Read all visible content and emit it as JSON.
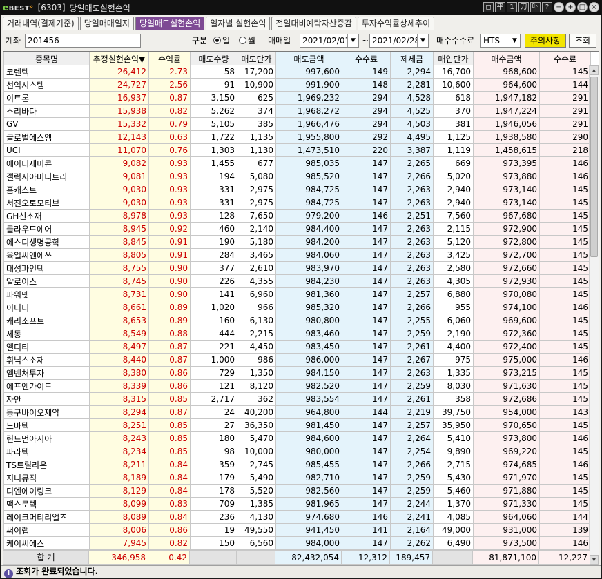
{
  "window": {
    "logo": "BEST",
    "code": "[6303]",
    "title": "당일매도실현손익",
    "buttons": [
      "◻",
      "平",
      "1",
      "刀",
      "卟",
      "?",
      "−",
      "+",
      "□",
      "×"
    ]
  },
  "tabs": [
    "거래내역(결제기준)",
    "당일매매일지",
    "당일매도실현손익",
    "일자별 실현손익",
    "전일대비예탁자산증감",
    "투자수익률상세추이"
  ],
  "active_tab": 2,
  "toolbar": {
    "account_label": "계좌",
    "account_value": "201456",
    "gubun_label": "구분",
    "radio_day": "일",
    "radio_month": "월",
    "trade_date_label": "매매일",
    "date_from": "2021/02/01",
    "tilde": "~",
    "date_to": "2021/02/28",
    "fee_label": "매수수수료",
    "fee_value": "HTS",
    "notice_button": "주의사항",
    "query_button": "조회",
    "dropdown_icon": "▼"
  },
  "columns": [
    "종목명",
    "추정실현손익▼",
    "수익률",
    "매도수량",
    "매도단가",
    "매도금액",
    "수수료",
    "제세금",
    "매입단가",
    "매수금액",
    "수수료"
  ],
  "rows": [
    [
      "코렌텍",
      "26,412",
      "2.73",
      "58",
      "17,200",
      "997,600",
      "149",
      "2,294",
      "16,700",
      "968,600",
      "145"
    ],
    [
      "선익시스템",
      "24,727",
      "2.56",
      "91",
      "10,900",
      "991,900",
      "148",
      "2,281",
      "10,600",
      "964,600",
      "144"
    ],
    [
      "이트론",
      "16,937",
      "0.87",
      "3,150",
      "625",
      "1,969,232",
      "294",
      "4,528",
      "618",
      "1,947,182",
      "291"
    ],
    [
      "소리바다",
      "15,938",
      "0.82",
      "5,262",
      "374",
      "1,968,272",
      "294",
      "4,525",
      "370",
      "1,947,224",
      "291"
    ],
    [
      "GV",
      "15,332",
      "0.79",
      "5,105",
      "385",
      "1,966,476",
      "294",
      "4,503",
      "381",
      "1,946,056",
      "291"
    ],
    [
      "글로벌에스엠",
      "12,143",
      "0.63",
      "1,722",
      "1,135",
      "1,955,800",
      "292",
      "4,495",
      "1,125",
      "1,938,580",
      "290"
    ],
    [
      "UCI",
      "11,070",
      "0.76",
      "1,303",
      "1,130",
      "1,473,510",
      "220",
      "3,387",
      "1,119",
      "1,458,615",
      "218"
    ],
    [
      "에이티세미콘",
      "9,082",
      "0.93",
      "1,455",
      "677",
      "985,035",
      "147",
      "2,265",
      "669",
      "973,395",
      "146"
    ],
    [
      "갤럭시아머니트리",
      "9,081",
      "0.93",
      "194",
      "5,080",
      "985,520",
      "147",
      "2,266",
      "5,020",
      "973,880",
      "146"
    ],
    [
      "홈캐스트",
      "9,030",
      "0.93",
      "331",
      "2,975",
      "984,725",
      "147",
      "2,263",
      "2,940",
      "973,140",
      "145"
    ],
    [
      "서진오토모티브",
      "9,030",
      "0.93",
      "331",
      "2,975",
      "984,725",
      "147",
      "2,263",
      "2,940",
      "973,140",
      "145"
    ],
    [
      "GH신소재",
      "8,978",
      "0.93",
      "128",
      "7,650",
      "979,200",
      "146",
      "2,251",
      "7,560",
      "967,680",
      "145"
    ],
    [
      "클라우드에어",
      "8,945",
      "0.92",
      "460",
      "2,140",
      "984,400",
      "147",
      "2,263",
      "2,115",
      "972,900",
      "145"
    ],
    [
      "에스디생명공학",
      "8,845",
      "0.91",
      "190",
      "5,180",
      "984,200",
      "147",
      "2,263",
      "5,120",
      "972,800",
      "145"
    ],
    [
      "육일씨엔에쓰",
      "8,805",
      "0.91",
      "284",
      "3,465",
      "984,060",
      "147",
      "2,263",
      "3,425",
      "972,700",
      "145"
    ],
    [
      "대성파인텍",
      "8,755",
      "0.90",
      "377",
      "2,610",
      "983,970",
      "147",
      "2,263",
      "2,580",
      "972,660",
      "145"
    ],
    [
      "알로이스",
      "8,745",
      "0.90",
      "226",
      "4,355",
      "984,230",
      "147",
      "2,263",
      "4,305",
      "972,930",
      "145"
    ],
    [
      "파워넷",
      "8,731",
      "0.90",
      "141",
      "6,960",
      "981,360",
      "147",
      "2,257",
      "6,880",
      "970,080",
      "145"
    ],
    [
      "이디티",
      "8,661",
      "0.89",
      "1,020",
      "966",
      "985,320",
      "147",
      "2,266",
      "955",
      "974,100",
      "146"
    ],
    [
      "캐리소프트",
      "8,653",
      "0.89",
      "160",
      "6,130",
      "980,800",
      "147",
      "2,255",
      "6,060",
      "969,600",
      "145"
    ],
    [
      "세동",
      "8,549",
      "0.88",
      "444",
      "2,215",
      "983,460",
      "147",
      "2,259",
      "2,190",
      "972,360",
      "145"
    ],
    [
      "엘디티",
      "8,497",
      "0.87",
      "221",
      "4,450",
      "983,450",
      "147",
      "2,261",
      "4,400",
      "972,400",
      "145"
    ],
    [
      "휘닉스소재",
      "8,440",
      "0.87",
      "1,000",
      "986",
      "986,000",
      "147",
      "2,267",
      "975",
      "975,000",
      "146"
    ],
    [
      "엠벤처투자",
      "8,380",
      "0.86",
      "729",
      "1,350",
      "984,150",
      "147",
      "2,263",
      "1,335",
      "973,215",
      "145"
    ],
    [
      "에프앤가이드",
      "8,339",
      "0.86",
      "121",
      "8,120",
      "982,520",
      "147",
      "2,259",
      "8,030",
      "971,630",
      "145"
    ],
    [
      "자안",
      "8,315",
      "0.85",
      "2,717",
      "362",
      "983,554",
      "147",
      "2,261",
      "358",
      "972,686",
      "145"
    ],
    [
      "동구바이오제약",
      "8,294",
      "0.87",
      "24",
      "40,200",
      "964,800",
      "144",
      "2,219",
      "39,750",
      "954,000",
      "143"
    ],
    [
      "노바텍",
      "8,251",
      "0.85",
      "27",
      "36,350",
      "981,450",
      "147",
      "2,257",
      "35,950",
      "970,650",
      "145"
    ],
    [
      "린드먼아시아",
      "8,243",
      "0.85",
      "180",
      "5,470",
      "984,600",
      "147",
      "2,264",
      "5,410",
      "973,800",
      "146"
    ],
    [
      "파라텍",
      "8,234",
      "0.85",
      "98",
      "10,000",
      "980,000",
      "147",
      "2,254",
      "9,890",
      "969,220",
      "145"
    ],
    [
      "TS트릴리온",
      "8,211",
      "0.84",
      "359",
      "2,745",
      "985,455",
      "147",
      "2,266",
      "2,715",
      "974,685",
      "146"
    ],
    [
      "지니뮤직",
      "8,189",
      "0.84",
      "179",
      "5,490",
      "982,710",
      "147",
      "2,259",
      "5,430",
      "971,970",
      "145"
    ],
    [
      "디엔에이링크",
      "8,129",
      "0.84",
      "178",
      "5,520",
      "982,560",
      "147",
      "2,259",
      "5,460",
      "971,880",
      "145"
    ],
    [
      "맥스로텍",
      "8,099",
      "0.83",
      "709",
      "1,385",
      "981,965",
      "147",
      "2,244",
      "1,370",
      "971,330",
      "145"
    ],
    [
      "레이크머티리얼즈",
      "8,089",
      "0.84",
      "236",
      "4,130",
      "974,680",
      "146",
      "2,241",
      "4,085",
      "964,060",
      "144"
    ],
    [
      "써이랩",
      "8,006",
      "0.86",
      "19",
      "49,550",
      "941,450",
      "141",
      "2,164",
      "49,000",
      "931,000",
      "139"
    ],
    [
      "케이씨에스",
      "7,945",
      "0.82",
      "150",
      "6,560",
      "984,000",
      "147",
      "2,262",
      "6,490",
      "973,500",
      "146"
    ]
  ],
  "total": [
    "합 계",
    "346,958",
    "0.42",
    "",
    "",
    "82,432,054",
    "12,312",
    "189,457",
    "",
    "81,871,100",
    "12,227"
  ],
  "status": {
    "icon": "i",
    "message": "조회가 완료되었습니다."
  }
}
